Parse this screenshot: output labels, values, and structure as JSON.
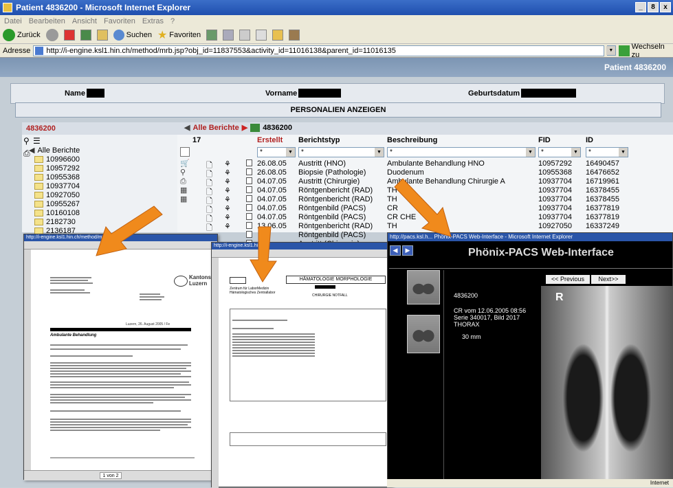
{
  "window": {
    "title": "Patient 4836200 - Microsoft Internet Explorer",
    "buttons": [
      "_",
      "8",
      "x"
    ]
  },
  "menu": {
    "items": [
      "Datei",
      "Bearbeiten",
      "Ansicht",
      "Favoriten",
      "Extras",
      "?"
    ]
  },
  "toolbar": {
    "back_label": "Zurück",
    "search_label": "Suchen",
    "favorites_label": "Favoriten"
  },
  "address": {
    "label": "Adresse",
    "url": "http://i-engine.ksl1.hin.ch/method/mrb.jsp?obj_id=11837553&activity_id=11016138&parent_id=11016135",
    "go_label": "Wechseln zu"
  },
  "header": {
    "patient": "Patient 4836200"
  },
  "patient": {
    "name_label": "Name",
    "vorname_label": "Vorname",
    "geburtsdatum_label": "Geburtsdatum"
  },
  "personalien_button": "PERSONALIEN ANZEIGEN",
  "left": {
    "id": "4836200",
    "root": "Alle Berichte",
    "folders": [
      "10996600",
      "10957292",
      "10955368",
      "10937704",
      "10927050",
      "10955267",
      "10160108",
      "2182730",
      "2136187"
    ]
  },
  "right": {
    "crumb_root": "Alle Berichte",
    "crumb_current": "4836200",
    "count": "17",
    "columns": {
      "erstellt": "Erstellt",
      "berichtstyp": "Berichtstyp",
      "beschreibung": "Beschreibung",
      "fid": "FID",
      "id": "ID"
    },
    "filter_value": "*",
    "rows": [
      {
        "date": "26.08.05",
        "type": "Austritt (HNO)",
        "desc": "Ambulante Behandlung HNO",
        "fid": "10957292",
        "id": "16490457"
      },
      {
        "date": "26.08.05",
        "type": "Biopsie (Pathologie)",
        "desc": "Duodenum",
        "fid": "10955368",
        "id": "16476652"
      },
      {
        "date": "04.07.05",
        "type": "Austritt (Chirurgie)",
        "desc": "Ambulante Behandlung Chirurgie A",
        "fid": "10937704",
        "id": "16719961"
      },
      {
        "date": "04.07.05",
        "type": "Röntgenbericht (RAD)",
        "desc": "TH",
        "fid": "10937704",
        "id": "16378455"
      },
      {
        "date": "04.07.05",
        "type": "Röntgenbericht (RAD)",
        "desc": "TH",
        "fid": "10937704",
        "id": "16378455"
      },
      {
        "date": "04.07.05",
        "type": "Röntgenbild (PACS)",
        "desc": "CR",
        "fid": "10937704",
        "id": "16377819"
      },
      {
        "date": "04.07.05",
        "type": "Röntgenbild (PACS)",
        "desc": "CR CHE",
        "fid": "10937704",
        "id": "16377819"
      },
      {
        "date": "13.06.05",
        "type": "Röntgenbericht (RAD)",
        "desc": "TH",
        "fid": "10927050",
        "id": "16337249"
      },
      {
        "date": "",
        "type": "Röntgenbild (PACS)",
        "desc": "",
        "fid": "",
        "id": ""
      },
      {
        "date": "",
        "type": "Austritt (Chirurgie)",
        "desc": "",
        "fid": "",
        "id": ""
      }
    ]
  },
  "letter": {
    "title_url": "http://i-engine.ksl1.hin.ch/method/mrb.jsp",
    "hospital": "Kantonsspital Luzern",
    "date_line": "Luzern, 26. August 2005 / Fe",
    "heading": "Ambulante Behandlung",
    "page_label": "1 von 2"
  },
  "lab": {
    "title_url": "http://i-engine.ksl1.hin.ch",
    "department": "HÄMATOLOGIE MORPHOLOGIE",
    "lab_name": "Zentrum für LaborMedizin Hämatologisches Zentrallabor",
    "station": "CHIRURGIE NOTFALL"
  },
  "pacs": {
    "window_title": "http://pacs.ksl.h... Phönix-PACS Web-Interface - Microsoft Internet Explorer",
    "title": "Phönix-PACS Web-Interface",
    "prev": "<< Previous",
    "next": "Next>>",
    "patient_id": "4836200",
    "study": "CR vom 12.06.2005 08:56",
    "series": "Serie 340017, Bild 2017",
    "region": "THORAX",
    "scale": "30 mm",
    "marker": "R",
    "status": "Internet"
  },
  "colors": {
    "accent_red": "#b02020",
    "header_blue": "#7c95b3",
    "arrow_orange": "#f08a1c"
  }
}
